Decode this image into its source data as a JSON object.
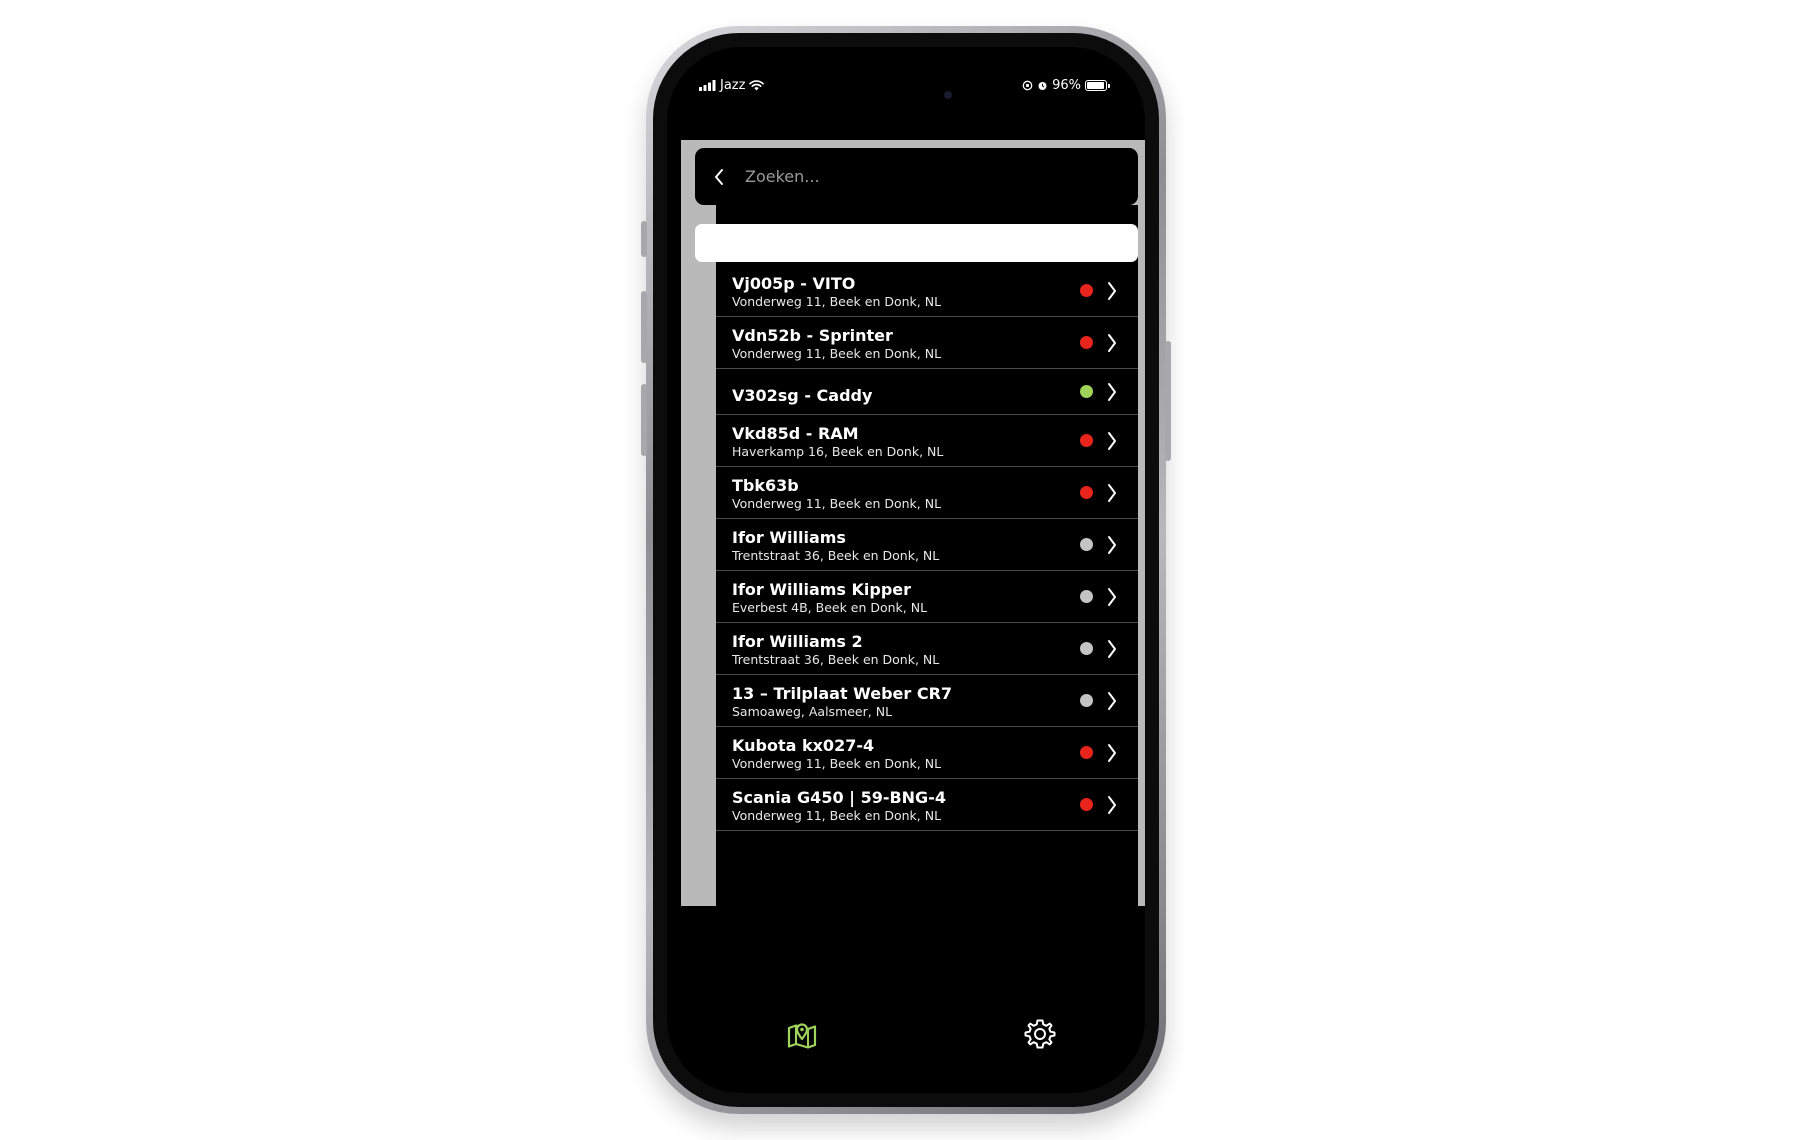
{
  "status_bar": {
    "carrier": "Jazz",
    "battery": "96%"
  },
  "search": {
    "placeholder": "Zoeken..."
  },
  "colors": {
    "red": "#e8241c",
    "green": "#9fd35a",
    "gray": "#c4c4c4",
    "accent": "#9fd35a"
  },
  "items": [
    {
      "name": "Vj005p - VITO",
      "address": "Vonderweg 11, Beek en Donk, NL",
      "status": "red"
    },
    {
      "name": "Vdn52b - Sprinter",
      "address": "Vonderweg 11, Beek en Donk, NL",
      "status": "red"
    },
    {
      "name": "V302sg - Caddy",
      "address": "",
      "status": "green"
    },
    {
      "name": "Vkd85d - RAM",
      "address": "Haverkamp 16, Beek en Donk, NL",
      "status": "red"
    },
    {
      "name": "Tbk63b",
      "address": "Vonderweg 11, Beek en Donk, NL",
      "status": "red"
    },
    {
      "name": "Ifor Williams",
      "address": "Trentstraat 36, Beek en Donk, NL",
      "status": "gray"
    },
    {
      "name": "Ifor Williams Kipper",
      "address": "Everbest 4B, Beek en Donk, NL",
      "status": "gray"
    },
    {
      "name": "Ifor Williams 2",
      "address": "Trentstraat 36, Beek en Donk, NL",
      "status": "gray"
    },
    {
      "name": "13 – Trilplaat Weber CR7",
      "address": "Samoaweg, Aalsmeer, NL",
      "status": "gray"
    },
    {
      "name": "Kubota kx027-4",
      "address": "Vonderweg 11, Beek en Donk, NL",
      "status": "red"
    },
    {
      "name": "Scania G450 | 59-BNG-4",
      "address": "Vonderweg 11, Beek en Donk, NL",
      "status": "red"
    }
  ],
  "tabbar": {
    "tabs": [
      {
        "icon": "map-icon",
        "active": true
      },
      {
        "icon": "gear-icon",
        "active": false
      }
    ]
  }
}
